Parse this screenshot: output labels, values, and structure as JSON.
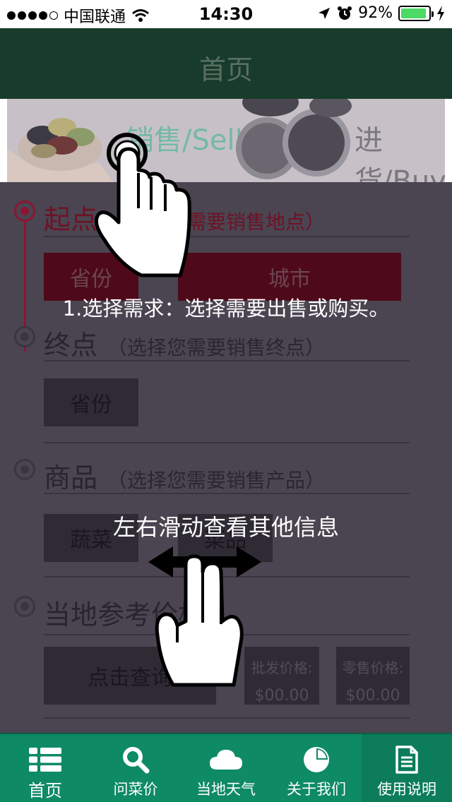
{
  "status_bar": {
    "carrier": "中国联通",
    "time": "14:30",
    "battery_percent": "92%",
    "battery_level": 0.92
  },
  "nav": {
    "title": "首页"
  },
  "banner": {
    "sell_label": "销售/Sell",
    "buy_label": "进货/Buy"
  },
  "form": {
    "start": {
      "title": "起点",
      "hint": "（选择您需要销售地点）",
      "province": "省份",
      "city": "城市"
    },
    "end": {
      "title": "终点",
      "hint": "（选择您需要销售终点）",
      "province": "省份"
    },
    "product": {
      "title": "商品",
      "hint": "（选择您需要销售产品）",
      "category": "蔬菜",
      "item": "菜品"
    },
    "price": {
      "title": "当地参考价格",
      "query_button": "点击查询",
      "wholesale_label": "批发价格:",
      "wholesale_value": "$00.00",
      "retail_label": "零售价格:",
      "retail_value": "$00.00"
    }
  },
  "overlay": {
    "tip_choose": "1.选择需求：选择需要出售或购买。",
    "tip_swipe": "左右滑动查看其他信息"
  },
  "tabs": [
    {
      "label": "首页",
      "icon": "list-icon"
    },
    {
      "label": "问菜价",
      "icon": "search-icon"
    },
    {
      "label": "当地天气",
      "icon": "cloud-icon"
    },
    {
      "label": "关于我们",
      "icon": "pie-chart-icon"
    },
    {
      "label": "使用说明",
      "icon": "document-icon"
    }
  ],
  "colors": {
    "nav_bg": "#173c2b",
    "tab_bg": "#0e8a64",
    "accent_red": "#8c1533",
    "overlay_bg": "#4a4551"
  }
}
